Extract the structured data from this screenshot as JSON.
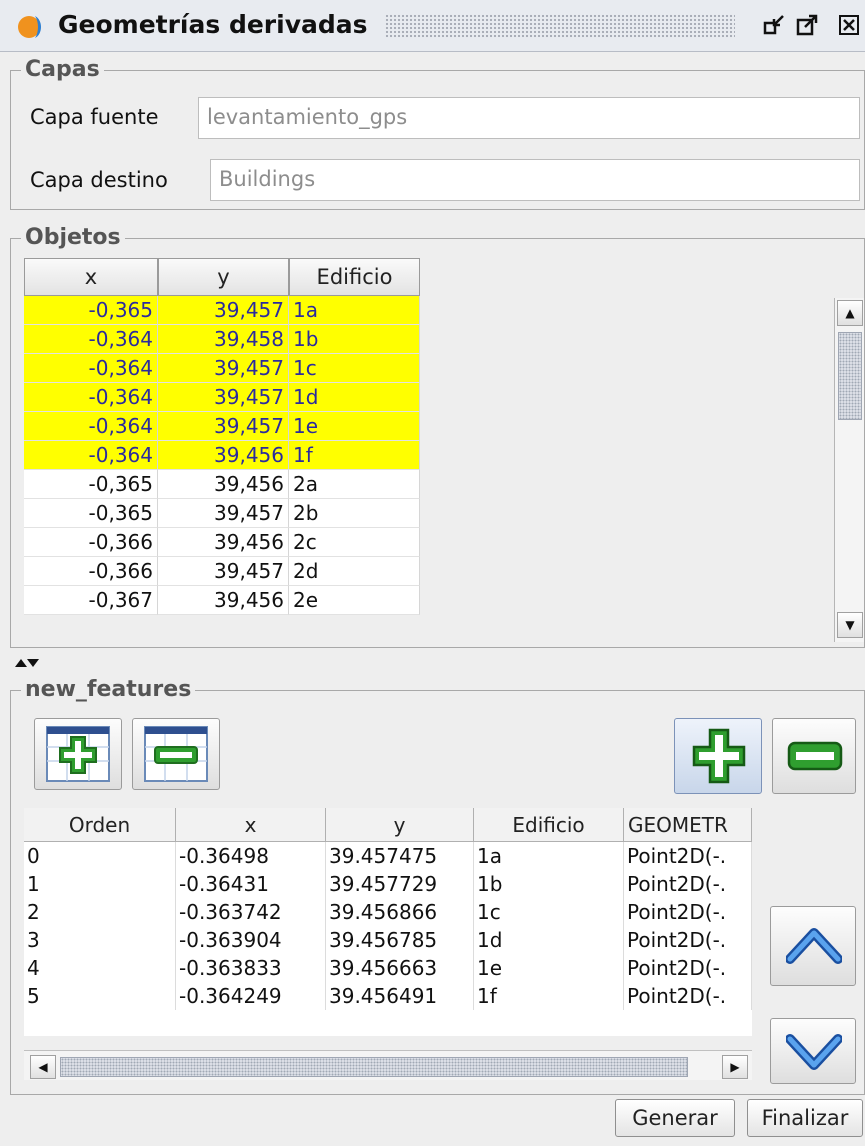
{
  "window": {
    "title": "Geometrías derivadas"
  },
  "capas": {
    "legend": "Capas",
    "fuente_label": "Capa fuente",
    "fuente_value": "levantamiento_gps",
    "destino_label": "Capa destino",
    "destino_value": "Buildings"
  },
  "objetos": {
    "legend": "Objetos",
    "columns": [
      "x",
      "y",
      "Edificio"
    ],
    "rows": [
      {
        "x": "-0,365",
        "y": "39,457",
        "edificio": "1a",
        "selected": true
      },
      {
        "x": "-0,364",
        "y": "39,458",
        "edificio": "1b",
        "selected": true
      },
      {
        "x": "-0,364",
        "y": "39,457",
        "edificio": "1c",
        "selected": true
      },
      {
        "x": "-0,364",
        "y": "39,457",
        "edificio": "1d",
        "selected": true
      },
      {
        "x": "-0,364",
        "y": "39,457",
        "edificio": "1e",
        "selected": true
      },
      {
        "x": "-0,364",
        "y": "39,456",
        "edificio": "1f",
        "selected": true
      },
      {
        "x": "-0,365",
        "y": "39,456",
        "edificio": "2a",
        "selected": false
      },
      {
        "x": "-0,365",
        "y": "39,457",
        "edificio": "2b",
        "selected": false
      },
      {
        "x": "-0,366",
        "y": "39,456",
        "edificio": "2c",
        "selected": false
      },
      {
        "x": "-0,366",
        "y": "39,457",
        "edificio": "2d",
        "selected": false
      },
      {
        "x": "-0,367",
        "y": "39,456",
        "edificio": "2e",
        "selected": false
      }
    ]
  },
  "new_features": {
    "legend": "new_features",
    "columns": [
      "Orden",
      "x",
      "y",
      "Edificio",
      "GEOMETR"
    ],
    "rows": [
      {
        "orden": "0",
        "x": "-0.36498",
        "y": "39.457475",
        "edificio": "1a",
        "geom": "Point2D(-."
      },
      {
        "orden": "1",
        "x": "-0.36431",
        "y": "39.457729",
        "edificio": "1b",
        "geom": "Point2D(-."
      },
      {
        "orden": "2",
        "x": "-0.363742",
        "y": "39.456866",
        "edificio": "1c",
        "geom": "Point2D(-."
      },
      {
        "orden": "3",
        "x": "-0.363904",
        "y": "39.456785",
        "edificio": "1d",
        "geom": "Point2D(-."
      },
      {
        "orden": "4",
        "x": "-0.363833",
        "y": "39.456663",
        "edificio": "1e",
        "geom": "Point2D(-."
      },
      {
        "orden": "5",
        "x": "-0.364249",
        "y": "39.456491",
        "edificio": "1f",
        "geom": "Point2D(-."
      }
    ]
  },
  "buttons": {
    "generar": "Generar",
    "finalizar": "Finalizar"
  },
  "colors": {
    "selection": "#ffff00",
    "selection_text": "#2b2b9e",
    "green": "#2f9e2f",
    "arrow_blue": "#2a6fd6"
  },
  "icons": [
    "app-logo-icon",
    "minimize-icon",
    "maximize-icon",
    "close-icon",
    "add-table-icon",
    "remove-table-icon",
    "add-icon",
    "remove-icon",
    "move-up-icon",
    "move-down-icon",
    "split-arrows-icon"
  ]
}
